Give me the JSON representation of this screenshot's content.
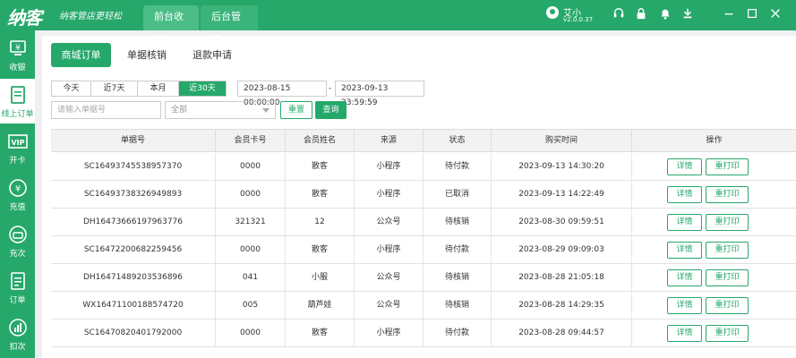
{
  "app": {
    "logo": "纳客",
    "slogan": "纳客管店更轻松",
    "nav": [
      "前台收银",
      "后台管理"
    ]
  },
  "user": {
    "name": "艾小",
    "version": "v2.0.0.37"
  },
  "topbar_icons": [
    "headset-icon",
    "lock-icon",
    "bell-icon",
    "download-icon",
    "minimize-icon",
    "maximize-icon",
    "close-icon"
  ],
  "sidebar": [
    {
      "label": "收银",
      "icon": "cashier-icon"
    },
    {
      "label": "线上订单",
      "icon": "online-order-icon"
    },
    {
      "label": "开卡",
      "icon": "vip-card-icon"
    },
    {
      "label": "充值",
      "icon": "recharge-icon"
    },
    {
      "label": "充次",
      "icon": "recharge-times-icon"
    },
    {
      "label": "订单",
      "icon": "order-icon"
    },
    {
      "label": "扣次",
      "icon": "deduct-icon"
    }
  ],
  "tabs": [
    "商城订单",
    "单据核销",
    "退款申请"
  ],
  "filters": {
    "ranges": [
      "今天",
      "近7天",
      "本月",
      "近30天"
    ],
    "date_start": "2023-08-15 00:00:00",
    "date_separator": "-",
    "date_end": "2023-09-13 23:59:59",
    "search_placeholder": "请输入单据号",
    "status_select": "全部",
    "reset_label": "重置",
    "query_label": "查询"
  },
  "table": {
    "headers": [
      "单据号",
      "会员卡号",
      "会员姓名",
      "来源",
      "状态",
      "购买时间",
      "操作"
    ],
    "detail_label": "详情",
    "reprint_label": "重打印",
    "rows": [
      {
        "order_no": "SC16493745538957370",
        "card_no": "0000",
        "member": "散客",
        "source": "小程序",
        "status": "待付款",
        "time": "2023-09-13 14:30:20"
      },
      {
        "order_no": "SC16493738326949893",
        "card_no": "0000",
        "member": "散客",
        "source": "小程序",
        "status": "已取消",
        "time": "2023-09-13 14:22:49"
      },
      {
        "order_no": "DH16473666197963776",
        "card_no": "321321",
        "member": "12",
        "source": "公众号",
        "status": "待核销",
        "time": "2023-08-30 09:59:51"
      },
      {
        "order_no": "SC16472200682259456",
        "card_no": "0000",
        "member": "散客",
        "source": "小程序",
        "status": "待付款",
        "time": "2023-08-29 09:09:03"
      },
      {
        "order_no": "DH16471489203536896",
        "card_no": "041",
        "member": "小服",
        "source": "公众号",
        "status": "待核销",
        "time": "2023-08-28 21:05:18"
      },
      {
        "order_no": "WX16471100188574720",
        "card_no": "005",
        "member": "葫芦娃",
        "source": "公众号",
        "status": "待核销",
        "time": "2023-08-28 14:29:35"
      },
      {
        "order_no": "SC16470820401792000",
        "card_no": "0000",
        "member": "散客",
        "source": "小程序",
        "status": "待付款",
        "time": "2023-08-28 09:44:57"
      }
    ]
  },
  "colors": {
    "brand": "#26a86b",
    "header_bg": "#f2f2f2"
  }
}
